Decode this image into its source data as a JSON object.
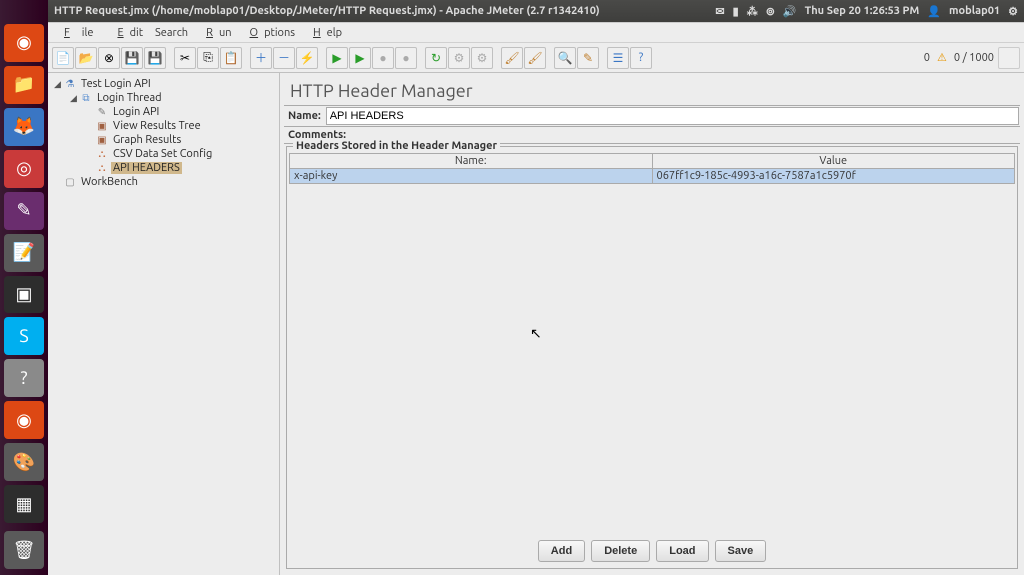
{
  "topbar": {
    "title": "HTTP Request.jmx (/home/moblap01/Desktop/JMeter/HTTP Request.jmx) - Apache JMeter (2.7 r1342410)",
    "time": "Thu Sep 20  1:26:53 PM",
    "user": "moblap01"
  },
  "menubar": {
    "file": "File",
    "edit": "Edit",
    "search": "Search",
    "run": "Run",
    "options": "Options",
    "help": "Help"
  },
  "toolbar": {
    "warn_count": "0",
    "counter": "0 / 1000"
  },
  "tree": {
    "root": "Test Login API",
    "thread": "Login Thread",
    "items": [
      "Login API",
      "View Results Tree",
      "Graph Results",
      "CSV Data Set Config",
      "API HEADERS"
    ],
    "workbench": "WorkBench"
  },
  "content": {
    "title": "HTTP Header Manager",
    "name_label": "Name:",
    "name_value": "API HEADERS",
    "comments_label": "Comments:",
    "fieldset_legend": "Headers Stored in the Header Manager",
    "col_name": "Name:",
    "col_value": "Value",
    "row": {
      "name": "x-api-key",
      "value": "067ff1c9-185c-4993-a16c-7587a1c5970f"
    },
    "buttons": {
      "add": "Add",
      "delete": "Delete",
      "load": "Load",
      "save": "Save"
    }
  }
}
